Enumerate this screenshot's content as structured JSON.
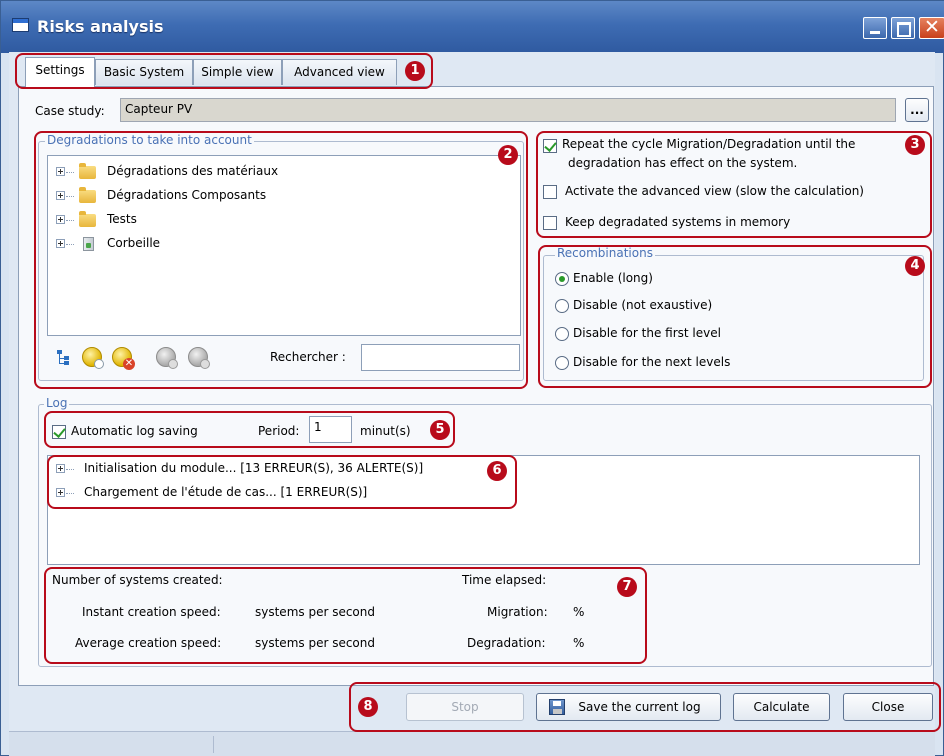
{
  "window": {
    "title": "Risks analysis"
  },
  "tabs": [
    {
      "label": "Settings",
      "active": true
    },
    {
      "label": "Basic System",
      "active": false
    },
    {
      "label": "Simple view",
      "active": false
    },
    {
      "label": "Advanced view",
      "active": false
    }
  ],
  "case_study": {
    "label": "Case study:",
    "value": "Capteur PV",
    "browse_label": "..."
  },
  "degradations": {
    "title": "Degradations to take into account",
    "tree": [
      {
        "label": "Dégradations des matériaux",
        "icon": "folder-icon"
      },
      {
        "label": "Dégradations Composants",
        "icon": "folder-icon"
      },
      {
        "label": "Tests",
        "icon": "folder-icon"
      },
      {
        "label": "Corbeille",
        "icon": "recycle-bin-icon"
      }
    ],
    "search_label": "Rechercher :",
    "search_value": ""
  },
  "options": {
    "repeat_cycle_line1": "Repeat the cycle Migration/Degradation until the",
    "repeat_cycle_line2": "degradation has effect on the system.",
    "repeat_cycle_checked": true,
    "advanced_view": "Activate the advanced view (slow the calculation)",
    "advanced_view_checked": false,
    "keep_degraded": "Keep degradated systems in memory",
    "keep_degraded_checked": false
  },
  "recombinations": {
    "title": "Recombinations",
    "options": [
      {
        "label": "Enable (long)",
        "selected": true
      },
      {
        "label": "Disable (not exaustive)",
        "selected": false
      },
      {
        "label": "Disable for the first level",
        "selected": false
      },
      {
        "label": "Disable for the next levels",
        "selected": false
      }
    ]
  },
  "log": {
    "title": "Log",
    "auto_save_label": "Automatic log saving",
    "auto_save_checked": true,
    "period_label": "Period:",
    "period_value": "1",
    "period_unit": "minut(s)",
    "entries": [
      "Initialisation du module... [13 ERREUR(S), 36 ALERTE(S)]",
      "Chargement de l'étude de cas... [1 ERREUR(S)]"
    ]
  },
  "stats": {
    "systems_created": "Number of systems created:",
    "instant_speed": "Instant creation speed:",
    "instant_speed_unit": "systems per second",
    "average_speed": "Average creation speed:",
    "average_speed_unit": "systems per second",
    "time_elapsed": "Time elapsed:",
    "migration": "Migration:",
    "migration_unit": "%",
    "degradation": "Degradation:",
    "degradation_unit": "%"
  },
  "buttons": {
    "stop": "Stop",
    "save_log": "Save the current log",
    "calculate": "Calculate",
    "close": "Close"
  },
  "annotations": [
    "1",
    "2",
    "3",
    "4",
    "5",
    "6",
    "7",
    "8"
  ],
  "colors": {
    "annotation": "#b80b1b",
    "titlebar": "#3e6cb3",
    "group_title": "#4a72b5"
  }
}
